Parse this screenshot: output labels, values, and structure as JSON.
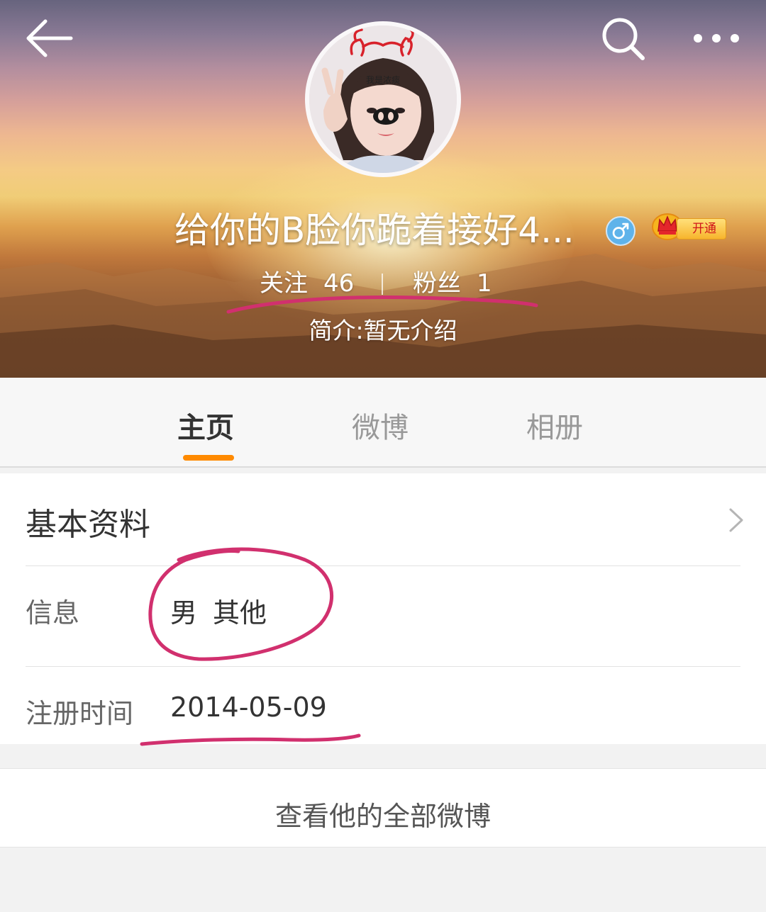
{
  "header": {
    "profile_name": "给你的B脸你跪着接好4...",
    "gender_symbol": "♂",
    "vip_label": "开通",
    "avatar_caption": "我是浓痰",
    "stats": {
      "follow_label": "关注",
      "follow_count": "46",
      "fans_label": "粉丝",
      "fans_count": "1"
    },
    "bio": "简介:暂无介绍"
  },
  "tabs": [
    {
      "label": "主页",
      "active": true
    },
    {
      "label": "微博",
      "active": false
    },
    {
      "label": "相册",
      "active": false
    }
  ],
  "info_card": {
    "title": "基本资料",
    "rows": {
      "info": {
        "label": "信息",
        "gender": "男",
        "location": "其他"
      },
      "registered": {
        "label": "注册时间",
        "value": "2014-05-09"
      }
    }
  },
  "view_all_label": "查看他的全部微博",
  "colors": {
    "tab_indicator": "#ff8a00",
    "annotation_pen": "#d1306e",
    "gender_badge": "#5fb3ea"
  }
}
